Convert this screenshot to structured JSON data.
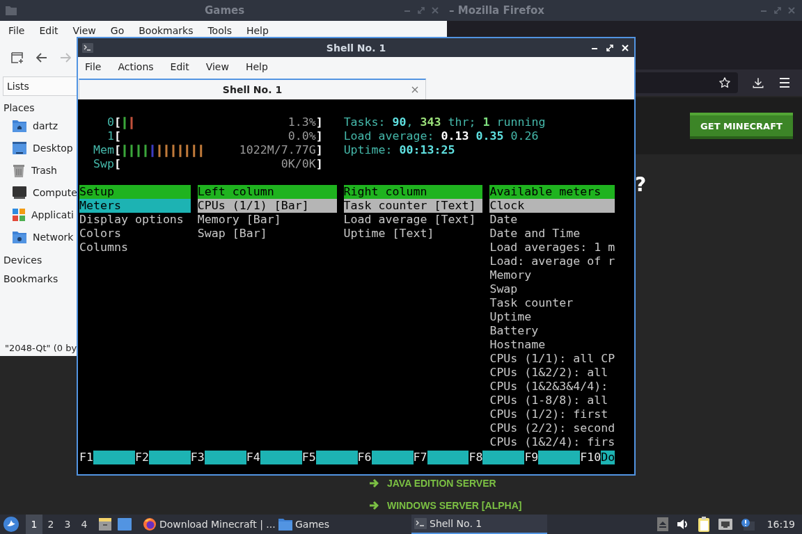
{
  "browser_window": {
    "title": "– Mozilla Firefox",
    "page": {
      "cta_button": "GET MINECRAFT",
      "heading_fragment": "?",
      "links": [
        "JAVA EDITION SERVER",
        "WINDOWS SERVER [ALPHA]"
      ]
    }
  },
  "file_manager_window": {
    "title": "Games",
    "menu": [
      "File",
      "Edit",
      "View",
      "Go",
      "Bookmarks",
      "Tools",
      "Help"
    ],
    "toolbar": [
      {
        "kind": "new-tab",
        "disabled": false
      },
      {
        "kind": "back",
        "disabled": false
      },
      {
        "kind": "forward",
        "disabled": true
      }
    ],
    "side_pane": {
      "view_selector": "Lists",
      "sections": [
        {
          "title": "Places",
          "items": [
            {
              "label": "dartz",
              "kind": "home"
            },
            {
              "label": "Desktop",
              "kind": "desktop"
            },
            {
              "label": "Trash",
              "kind": "trash"
            },
            {
              "label": "Compute",
              "kind": "computer"
            },
            {
              "label": "Applicati",
              "kind": "applications"
            },
            {
              "label": "Network",
              "kind": "network"
            }
          ]
        },
        {
          "title": "Devices"
        },
        {
          "title": "Bookmarks"
        }
      ]
    },
    "status_bar": "\"2048-Qt\" (0 by"
  },
  "terminal_window": {
    "title": "Shell No. 1",
    "menu": [
      "File",
      "Actions",
      "Edit",
      "View",
      "Help"
    ],
    "tabs": [
      {
        "label": "Shell No. 1",
        "selected": true
      }
    ],
    "htop": {
      "meters": [
        {
          "label": "0",
          "open": "[",
          "bars": [
            {
              "text": "|",
              "color": "#3aa53a"
            },
            {
              "text": "|",
              "color": "#c0503a"
            }
          ],
          "value": "1.3%",
          "close": "]"
        },
        {
          "label": "1",
          "open": "[",
          "value": "0.0%",
          "close": "]"
        },
        {
          "label": "Mem",
          "open": "[",
          "bars": [
            {
              "text": "||||",
              "color": "#3aa53a"
            },
            {
              "text": "|",
              "color": "#3b3bc0"
            },
            {
              "text": "|||||||",
              "color": "#c07a3a"
            }
          ],
          "value": "1022M/7.77G",
          "close": "]"
        },
        {
          "label": "Swp",
          "open": "[",
          "value": "0K/0K",
          "close": "]"
        }
      ],
      "summary": [
        [
          {
            "text": "Tasks: ",
            "color": "#45b8aa",
            "bold": false
          },
          {
            "text": "90",
            "color": "#5fe0e0",
            "bold": true
          },
          {
            "text": ", ",
            "color": "#45b8aa",
            "bold": false
          },
          {
            "text": "343",
            "color": "#9be07a",
            "bold": true
          },
          {
            "text": " thr; ",
            "color": "#45b8aa",
            "bold": false
          },
          {
            "text": "1",
            "color": "#7fe07f",
            "bold": true
          },
          {
            "text": " running",
            "color": "#45b8aa",
            "bold": false
          }
        ],
        [
          {
            "text": "Load average: ",
            "color": "#45b8aa",
            "bold": false
          },
          {
            "text": "0.13 ",
            "color": "#ffffff",
            "bold": true
          },
          {
            "text": "0.35 ",
            "color": "#5fe0e0",
            "bold": true
          },
          {
            "text": "0.26",
            "color": "#45b8aa",
            "bold": false
          }
        ],
        [
          {
            "text": "Uptime: ",
            "color": "#45b8aa",
            "bold": false
          },
          {
            "text": "00:13:25",
            "color": "#5fe0e0",
            "bold": true
          }
        ]
      ],
      "panels": [
        {
          "title": "Setup",
          "focused": true,
          "items": [
            {
              "label": "Meters",
              "selected": true
            },
            {
              "label": "Display options",
              "selected": false
            },
            {
              "label": "Colors",
              "selected": false
            },
            {
              "label": "Columns",
              "selected": false
            }
          ]
        },
        {
          "title": "Left column",
          "focused": false,
          "items": [
            {
              "label": "CPUs (1/1) [Bar]",
              "selected": true
            },
            {
              "label": "Memory [Bar]",
              "selected": false
            },
            {
              "label": "Swap [Bar]",
              "selected": false
            }
          ]
        },
        {
          "title": "Right column",
          "focused": false,
          "items": [
            {
              "label": "Task counter [Text]",
              "selected": true
            },
            {
              "label": "Load average [Text]",
              "selected": false
            },
            {
              "label": "Uptime [Text]",
              "selected": false
            }
          ]
        },
        {
          "title": "Available meters",
          "focused": false,
          "items": [
            {
              "label": "Clock",
              "selected": true
            },
            {
              "label": "Date",
              "selected": false
            },
            {
              "label": "Date and Time",
              "selected": false
            },
            {
              "label": "Load averages: 1 m",
              "selected": false
            },
            {
              "label": "Load: average of r",
              "selected": false
            },
            {
              "label": "Memory",
              "selected": false
            },
            {
              "label": "Swap",
              "selected": false
            },
            {
              "label": "Task counter",
              "selected": false
            },
            {
              "label": "Uptime",
              "selected": false
            },
            {
              "label": "Battery",
              "selected": false
            },
            {
              "label": "Hostname",
              "selected": false
            },
            {
              "label": "CPUs (1/1): all CP",
              "selected": false
            },
            {
              "label": "CPUs (1&2/2): all",
              "selected": false
            },
            {
              "label": "CPUs (1&2&3&4/4):",
              "selected": false
            },
            {
              "label": "CPUs (1-8/8): all",
              "selected": false
            },
            {
              "label": "CPUs (1/2): first",
              "selected": false
            },
            {
              "label": "CPUs (2/2): second",
              "selected": false
            },
            {
              "label": "CPUs (1&2/4): firs",
              "selected": false
            }
          ]
        }
      ],
      "function_keys": [
        {
          "key": "F1"
        },
        {
          "key": "F2"
        },
        {
          "key": "F3"
        },
        {
          "key": "F4"
        },
        {
          "key": "F5"
        },
        {
          "key": "F6"
        },
        {
          "key": "F7"
        },
        {
          "key": "F8"
        },
        {
          "key": "F9"
        },
        {
          "key": "F10",
          "label": "Do"
        }
      ]
    }
  },
  "taskbar": {
    "workspaces": [
      {
        "label": "1",
        "selected": true
      },
      {
        "label": "2",
        "selected": false
      },
      {
        "label": "3",
        "selected": false
      },
      {
        "label": "4",
        "selected": false
      }
    ],
    "launchers": [
      {
        "kind": "file-manager"
      },
      {
        "kind": "desktop"
      }
    ],
    "tasks": [
      {
        "label": "Download Minecraft | ...",
        "kind": "browser",
        "selected": false
      },
      {
        "label": "Games",
        "kind": "folder",
        "selected": false
      },
      {
        "label": "Shell No. 1",
        "kind": "terminal",
        "selected": true
      }
    ],
    "tray": [
      {
        "kind": "eject"
      },
      {
        "kind": "volume"
      },
      {
        "kind": "clipboard"
      },
      {
        "kind": "network"
      },
      {
        "kind": "notification"
      }
    ],
    "clock": "16:19"
  }
}
